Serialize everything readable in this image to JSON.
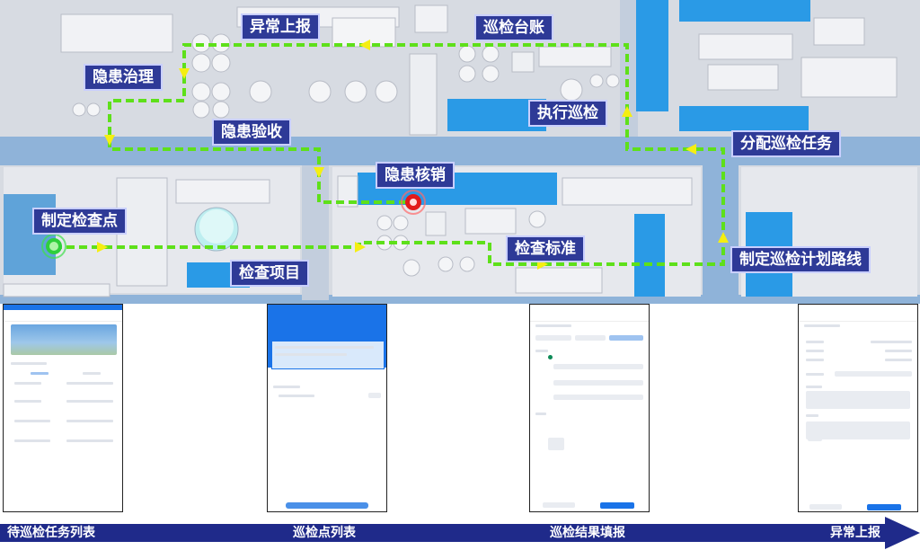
{
  "labels": {
    "exception_report": "异常上报",
    "inspection_ledger": "巡检台账",
    "hazard_governance": "隐患治理",
    "hazard_acceptance": "隐患验收",
    "execute_inspection": "执行巡检",
    "assign_task": "分配巡检任务",
    "hazard_writeoff": "隐患核销",
    "set_checkpoint": "制定检查点",
    "inspection_standard": "检查标准",
    "inspection_items": "检查项目",
    "set_route": "制定巡检计划路线"
  },
  "flow": {
    "steps": [
      "待巡检任务列表",
      "巡检点列表",
      "巡检结果填报",
      "异常上报"
    ]
  },
  "colors": {
    "route": "#5ee01a",
    "arrow": "#f5ee12",
    "tag_bg": "#2e3a97",
    "flow_bar": "#1f2a8a",
    "road": "#8fb3d9",
    "blue_building": "#2a9ae6"
  },
  "icons": {
    "start": "green-target-icon",
    "hazard": "red-target-icon"
  }
}
